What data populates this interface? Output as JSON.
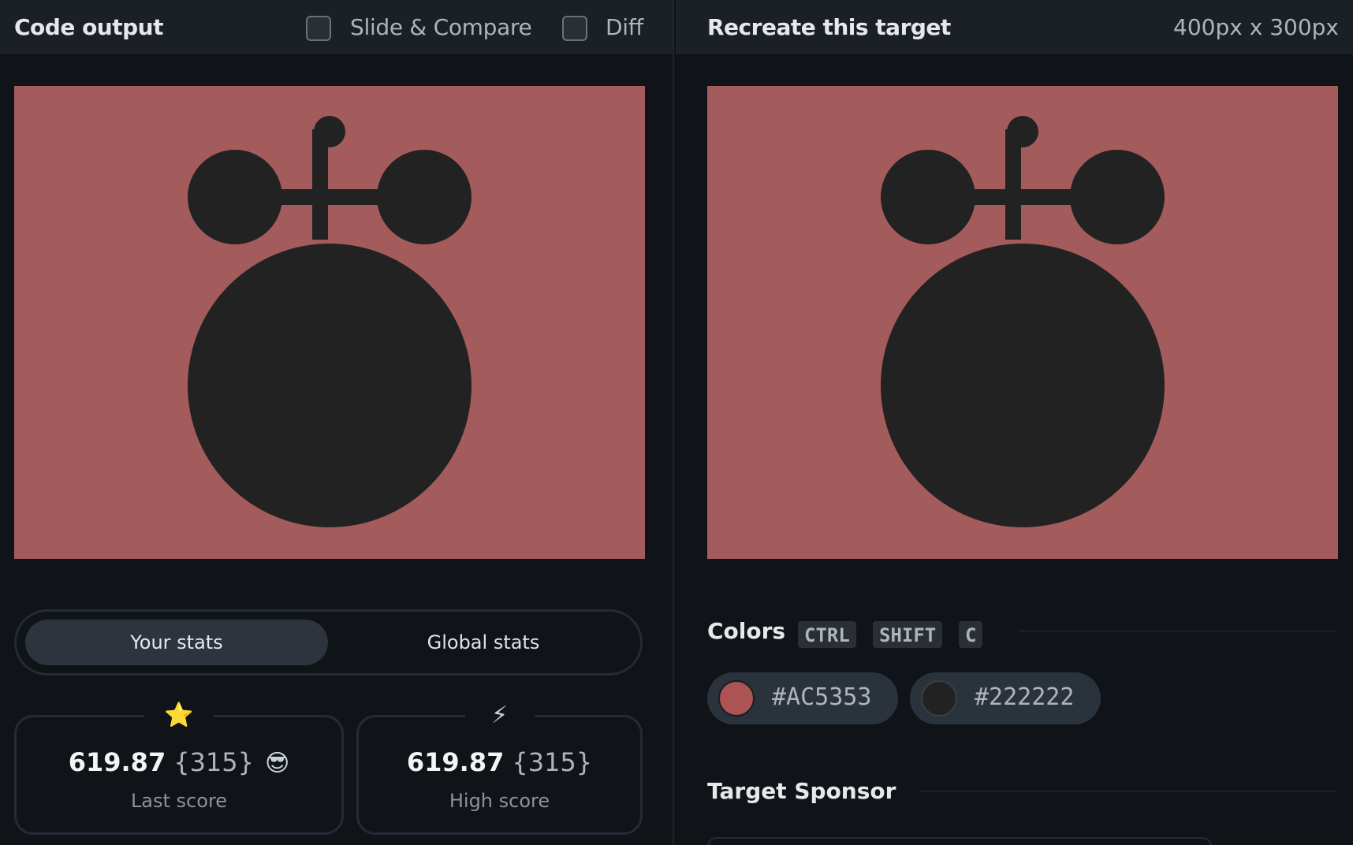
{
  "left_panel": {
    "title": "Code output",
    "slide_compare_label": "Slide & Compare",
    "diff_label": "Diff",
    "canvas": {
      "background": "#AC5353",
      "shape_color": "#222222"
    },
    "stats_tabs": {
      "your_stats": "Your stats",
      "global_stats": "Global stats"
    },
    "stats": [
      {
        "icon": "⭐",
        "value": "619.87",
        "count": "{315}",
        "emoji": "😎",
        "label": "Last score"
      },
      {
        "icon": "⚡",
        "value": "619.87",
        "count": "{315}",
        "emoji": "",
        "label": "High score"
      }
    ]
  },
  "right_panel": {
    "title": "Recreate this target",
    "size": "400px x 300px",
    "colors": {
      "heading": "Colors",
      "shortcut": [
        "CTRL",
        "SHIFT",
        "C"
      ],
      "swatches": [
        {
          "hex": "#AC5353",
          "color": "#AC5353"
        },
        {
          "hex": "#222222",
          "color": "#222222"
        }
      ]
    },
    "sponsor_heading": "Target Sponsor"
  }
}
